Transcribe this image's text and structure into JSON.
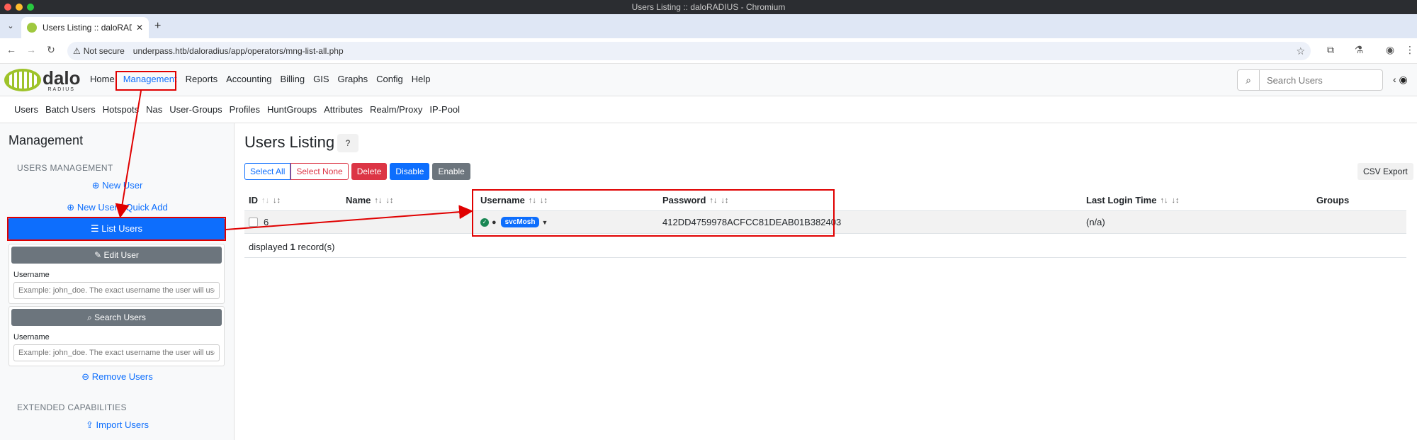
{
  "window": {
    "title": "Users Listing :: daloRADIUS - Chromium"
  },
  "tab": {
    "title": "Users Listing :: daloRADIUS",
    "close": "✕",
    "new": "+"
  },
  "address": {
    "security_label": "Not secure",
    "url": "underpass.htb/daloradius/app/operators/mng-list-all.php"
  },
  "logo": {
    "name": "dalo",
    "sub": "RADIUS"
  },
  "main_nav": [
    "Home",
    "Management",
    "Reports",
    "Accounting",
    "Billing",
    "GIS",
    "Graphs",
    "Config",
    "Help"
  ],
  "search": {
    "placeholder": "Search Users"
  },
  "sub_nav": [
    "Users",
    "Batch Users",
    "Hotspots",
    "Nas",
    "User-Groups",
    "Profiles",
    "HuntGroups",
    "Attributes",
    "Realm/Proxy",
    "IP-Pool"
  ],
  "sidebar": {
    "title": "Management",
    "section_users": "USERS MANAGEMENT",
    "new_user": "New User",
    "new_user_quick": "New User - Quick Add",
    "list_users": "List Users",
    "edit_user_btn": "Edit User",
    "edit_username_label": "Username",
    "edit_username_placeholder": "Example: john_doe. The exact username the user will use to",
    "search_users_btn": "Search Users",
    "search_username_label": "Username",
    "search_username_placeholder": "Example: john_doe. The exact username the user will use to",
    "remove_users": "Remove Users",
    "section_extended": "EXTENDED CAPABILITIES",
    "import_users": "Import Users"
  },
  "main": {
    "title": "Users Listing",
    "actions": {
      "select_all": "Select All",
      "select_none": "Select None",
      "delete": "Delete",
      "disable": "Disable",
      "enable": "Enable"
    },
    "csv_export": "CSV Export",
    "columns": {
      "id": "ID",
      "name": "Name",
      "username": "Username",
      "password": "Password",
      "last_login": "Last Login Time",
      "groups": "Groups"
    },
    "rows": [
      {
        "id": "6",
        "name": "",
        "username": "svcMosh",
        "password": "412DD4759978ACFCC81DEAB01B382403",
        "last_login": "(n/a)",
        "groups": ""
      }
    ],
    "footer_prefix": "displayed ",
    "footer_count": "1",
    "footer_suffix": " record(s)"
  },
  "colors": {
    "primary": "#0d6efd",
    "danger": "#dc3545",
    "secondary": "#6c757d",
    "success": "#198754",
    "annotation": "#e00000",
    "logo_green": "#9ec32a"
  }
}
